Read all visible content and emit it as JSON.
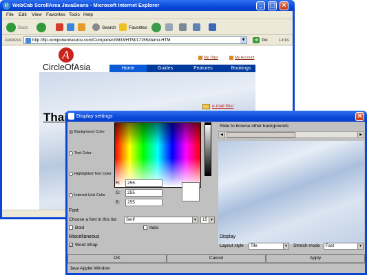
{
  "ie": {
    "title": "WebCab ScrollArea JavaBeans - Microsoft Internet Explorer",
    "menu": [
      "File",
      "Edit",
      "View",
      "Favorites",
      "Tools",
      "Help"
    ],
    "toolbar": {
      "back": "Back",
      "search": "Search",
      "favorites": "Favorites"
    },
    "address_label": "Address",
    "address_url": "http://ftp.componentsource.com/Componen/9933/HTM/17155/demo.HTM",
    "go_label": "Go",
    "links_label": "Links"
  },
  "site": {
    "logo_letter": "A",
    "logo_text": "CircleOfAsia",
    "top_links": [
      "My Trips",
      "My Account"
    ],
    "nav": [
      "Home",
      "Guides",
      "Features",
      "Bookings"
    ],
    "hero_title": "Thailand",
    "email_link": "e-mail this!"
  },
  "dialog": {
    "title": "Display settings",
    "color_targets": [
      "Background Color",
      "Text Color",
      "Highlighted Text Color",
      "Internet Link Color"
    ],
    "rgb": {
      "r_label": "R:",
      "g_label": "G:",
      "b_label": "B:",
      "r": "255",
      "g": "255",
      "b": "255"
    },
    "slider_hint": "Slide to browse other backgrounds",
    "font": {
      "section": "Font",
      "choose_label": "Choose a font in this list",
      "family": "Serif",
      "size": "15",
      "bold": "Bold",
      "italic": "Italic"
    },
    "misc": {
      "section": "Miscellaneous",
      "word_wrap": "Word Wrap"
    },
    "display": {
      "section": "Display",
      "layout_label": "Layout style",
      "layout_value": "Tile",
      "stretch_label": "Stretch mode",
      "stretch_value": "Fast"
    },
    "buttons": {
      "ok": "OK",
      "cancel": "Cancel",
      "apply": "Apply"
    },
    "status": "Java Applet Window"
  },
  "colors": {
    "xp_title": "#0a46d6",
    "nav_bar": "#003a9c",
    "logo_red": "#c8231d",
    "dialog_bg": "#c0c0c0"
  }
}
